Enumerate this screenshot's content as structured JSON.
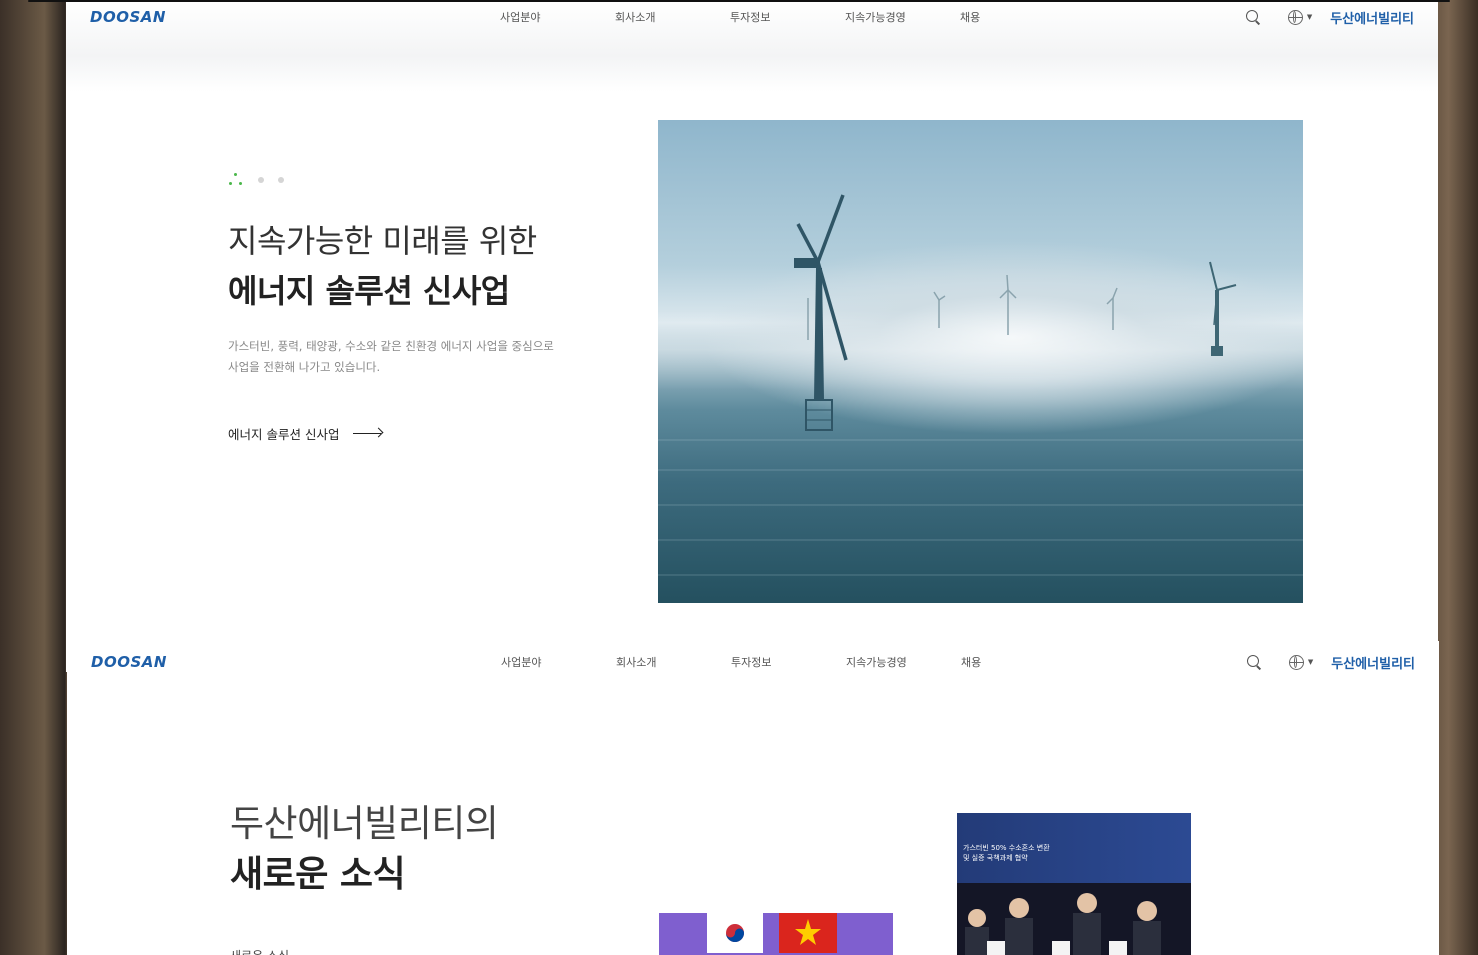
{
  "brand": {
    "logo": "DOOSAN",
    "site_name": "두산에너빌리티",
    "accent": "#1f5fa8"
  },
  "nav": {
    "items": [
      "사업분야",
      "회사소개",
      "투자정보",
      "지속가능경영",
      "채용"
    ]
  },
  "hero": {
    "line1": "지속가능한 미래를 위한",
    "line2": "에너지 솔루션 신사업",
    "desc_line1": "가스터빈, 풍력, 태양광, 수소와 같은 친환경 에너지 사업을 중심으로",
    "desc_line2": "사업을 전환해 나가고 있습니다.",
    "cta": "에너지 솔루션 신사업",
    "slides": 3,
    "active_slide": 1
  },
  "news": {
    "title1": "두산에너빌리티의",
    "title2": "새로운 소식",
    "link": "새로운 소식",
    "card2_caption_line1": "가스터빈 50% 수소혼소 변환",
    "card2_caption_line2": "및 실증 국책과제 협약"
  },
  "icons": [
    "search-icon",
    "globe-icon",
    "arrow-right-icon"
  ]
}
